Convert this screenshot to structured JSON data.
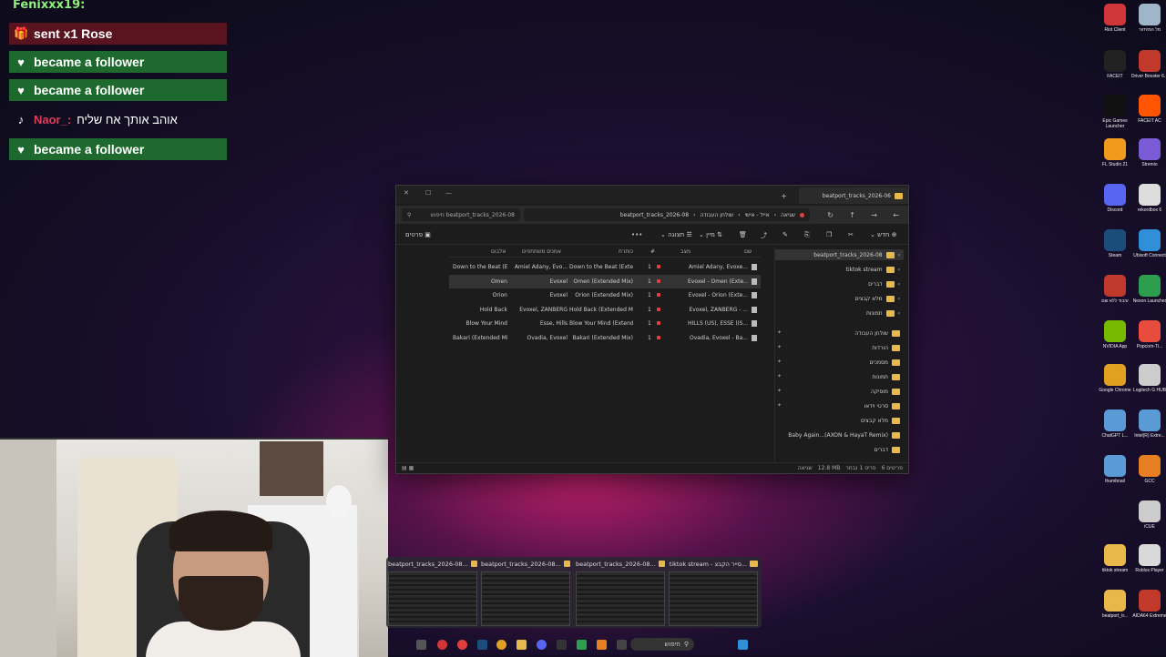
{
  "chat": {
    "top_user": "Fenixxx19:",
    "alerts": [
      {
        "type": "rose",
        "icon": "gift-icon",
        "text": "sent x1 Rose"
      },
      {
        "type": "follow",
        "icon": "heart-icon",
        "text": "became a follower"
      },
      {
        "type": "follow",
        "icon": "heart-icon",
        "text": "became a follower"
      },
      {
        "type": "msg",
        "icon": "tiktok-icon",
        "nick": "Naor_:",
        "text": "אוהב אותך אח שליח"
      },
      {
        "type": "follow",
        "icon": "heart-icon",
        "text": "became a follower"
      }
    ]
  },
  "explorer": {
    "tab_title": "beatport_tracks_2026-06",
    "breadcrumb": [
      "שגיאה",
      "אייל - אישי",
      "שולחן העבודה",
      "beatport_tracks_2026-08"
    ],
    "search_placeholder": "חיפוש beatport_tracks_2026-08",
    "toolbar": {
      "new": "חדש",
      "sort": "מיין",
      "view": "תצוגה",
      "more": "•••",
      "details": "פרטים"
    },
    "columns": {
      "name": "שם",
      "status": "מצב",
      "num": "#",
      "title": "כותרת",
      "artists": "אמנים משתתפים",
      "album": "אלבום"
    },
    "rows": [
      {
        "name": "Amiel Adany, Evoxe...",
        "num": "1",
        "title": "Down to the Beat (Extend...",
        "artists": "Amiel Adany, Evo...",
        "album": "Down to the Beat (Ext..."
      },
      {
        "name": "Evoxel - Omen (Exte...",
        "num": "1",
        "title": "Omen (Extended Mix)",
        "artists": "Evoxel",
        "album": "Omen"
      },
      {
        "name": "Evoxel - Orion (Exte...",
        "num": "1",
        "title": "Orion (Extended Mix)",
        "artists": "Evoxel",
        "album": "Orion"
      },
      {
        "name": "Evoxel, ZANBERG - ...",
        "num": "1",
        "title": "Hold Back (Extended Mix)",
        "artists": "Evoxel, ZANBERG",
        "album": "Hold Back"
      },
      {
        "name": "HILLS (US), ESSE (IS...",
        "num": "1",
        "title": "Blow Your Mind (Extende...",
        "artists": "Esse, Hills",
        "album": "Blow Your Mind"
      },
      {
        "name": "Ovadia, Evoxel - Ba...",
        "num": "1",
        "title": "Bakari (Extended Mix)",
        "artists": "Ovadia, Evoxel",
        "album": "Bakari (Extended Mix)"
      }
    ],
    "nav": [
      {
        "label": "beatport_tracks_2026-08",
        "selected": true
      },
      {
        "label": "tiktok stream"
      },
      {
        "label": "דברים"
      },
      {
        "label": "מלא קבצים"
      },
      {
        "label": "תמונות"
      },
      {
        "label": "שולחן העבודה",
        "pinned": true
      },
      {
        "label": "הורדות",
        "pinned": true
      },
      {
        "label": "מסמכים",
        "pinned": true
      },
      {
        "label": "תמונות",
        "pinned": true
      },
      {
        "label": "מוסיקה",
        "pinned": true
      },
      {
        "label": "סרטי וידאו",
        "pinned": true
      },
      {
        "label": "מלא קבצים"
      },
      {
        "label": "Baby Again...(AXON & HayaT Remix)"
      },
      {
        "label": "דברים"
      }
    ],
    "status": {
      "items": "6 פריטים",
      "selected": "פריט 1 נבחר",
      "size": "12.8 MB",
      "state": "שגיאה"
    }
  },
  "previews": [
    {
      "title": "beatport_tracks_2026-08..."
    },
    {
      "title": "beatport_tracks_2026-08..."
    },
    {
      "title": "beatport_tracks_2026-08..."
    },
    {
      "title": "tiktok stream - סייר הקבצ..."
    }
  ],
  "taskbar": {
    "search_label": "חיפוש"
  },
  "desktop_icons": [
    {
      "label": "Riot Client",
      "color": "#d13639"
    },
    {
      "label": "סל המיחזור",
      "color": "#9fb6c8"
    },
    {
      "label": "FACEIT",
      "color": "#222222"
    },
    {
      "label": "Driver Booster 6...",
      "color": "#c0392b"
    },
    {
      "label": "Epic Games Launcher",
      "color": "#111111"
    },
    {
      "label": "FACEIT AC",
      "color": "#ff5500"
    },
    {
      "label": "FL Studio 21",
      "color": "#f29a1c"
    },
    {
      "label": "Stremio",
      "color": "#7b5bd6"
    },
    {
      "label": "Discord",
      "color": "#5865f2"
    },
    {
      "label": "rekordbox 6",
      "color": "#dddddd"
    },
    {
      "label": "Steam",
      "color": "#1b4d7a"
    },
    {
      "label": "Ubisoft Connect",
      "color": "#2f8fd8"
    },
    {
      "label": "עיבוד ללא שם",
      "color": "#c0392b"
    },
    {
      "label": "Nexon Launcher",
      "color": "#2d9e4d"
    },
    {
      "label": "NVIDIA App",
      "color": "#76b900"
    },
    {
      "label": "Popcorn-Ti...",
      "color": "#e74c3c"
    },
    {
      "label": "Google Chrome",
      "color": "#e0a020"
    },
    {
      "label": "Logitech G HUB",
      "color": "#cccccc"
    },
    {
      "label": "ChatGPT L...",
      "color": "#5b9bd5"
    },
    {
      "label": "Intel(R) Extre...",
      "color": "#5b9bd5"
    },
    {
      "label": "thumbnail",
      "color": "#5b9bd5"
    },
    {
      "label": "GCC",
      "color": "#e67e22"
    },
    {
      "label": "iCUE",
      "color": "#cccccc"
    },
    {
      "label": "tiktok stream",
      "color": "#e8b84a"
    },
    {
      "label": "Roblox Player",
      "color": "#d9d9d9"
    },
    {
      "label": "beatport_tr...",
      "color": "#e8b84a"
    },
    {
      "label": "AIDA64 Extreme",
      "color": "#c0392b"
    }
  ]
}
